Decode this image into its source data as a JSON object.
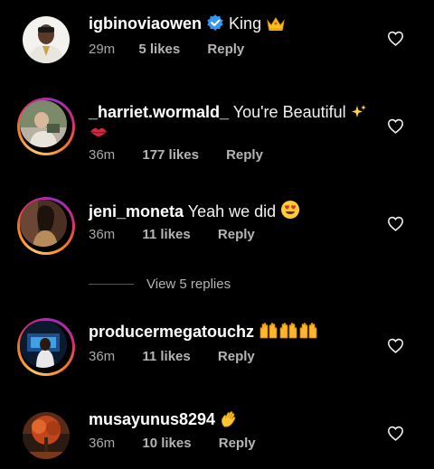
{
  "comments": [
    {
      "username": "igbinoviaowen",
      "verified": true,
      "text": "King",
      "emoji": "crown",
      "time": "29m",
      "likes": "5 likes",
      "reply": "Reply",
      "avatar": "avatar-photo",
      "story_ring": false
    },
    {
      "username": "_harriet.wormald_",
      "verified": false,
      "text": "You're Beautiful",
      "emoji": "sparkles + kiss-mark",
      "time": "36m",
      "likes": "177 likes",
      "reply": "Reply",
      "avatar": "avatar-photo",
      "story_ring": true
    },
    {
      "username": "jeni_moneta",
      "verified": false,
      "text": "Yeah we did",
      "emoji": "heart-eyes",
      "time": "36m",
      "likes": "11 likes",
      "reply": "Reply",
      "avatar": "avatar-photo",
      "story_ring": true
    },
    {
      "username": "producermegatouchz",
      "verified": false,
      "text": "",
      "emoji": "raised-hands x3",
      "time": "36m",
      "likes": "11 likes",
      "reply": "Reply",
      "avatar": "avatar-photo",
      "story_ring": true
    },
    {
      "username": "musayunus8294",
      "verified": false,
      "text": "",
      "emoji": "waving-hand",
      "time": "36m",
      "likes": "10 likes",
      "reply": "Reply",
      "avatar": "avatar-photo",
      "story_ring": false
    }
  ],
  "view_replies": "View 5 replies",
  "colors": {
    "background": "#000000",
    "username": "#ffffff",
    "meta": "#a8a8a8",
    "verified": "#3897f0"
  },
  "icons": {
    "like": "heart-outline-icon",
    "verified": "verified-badge-icon"
  }
}
